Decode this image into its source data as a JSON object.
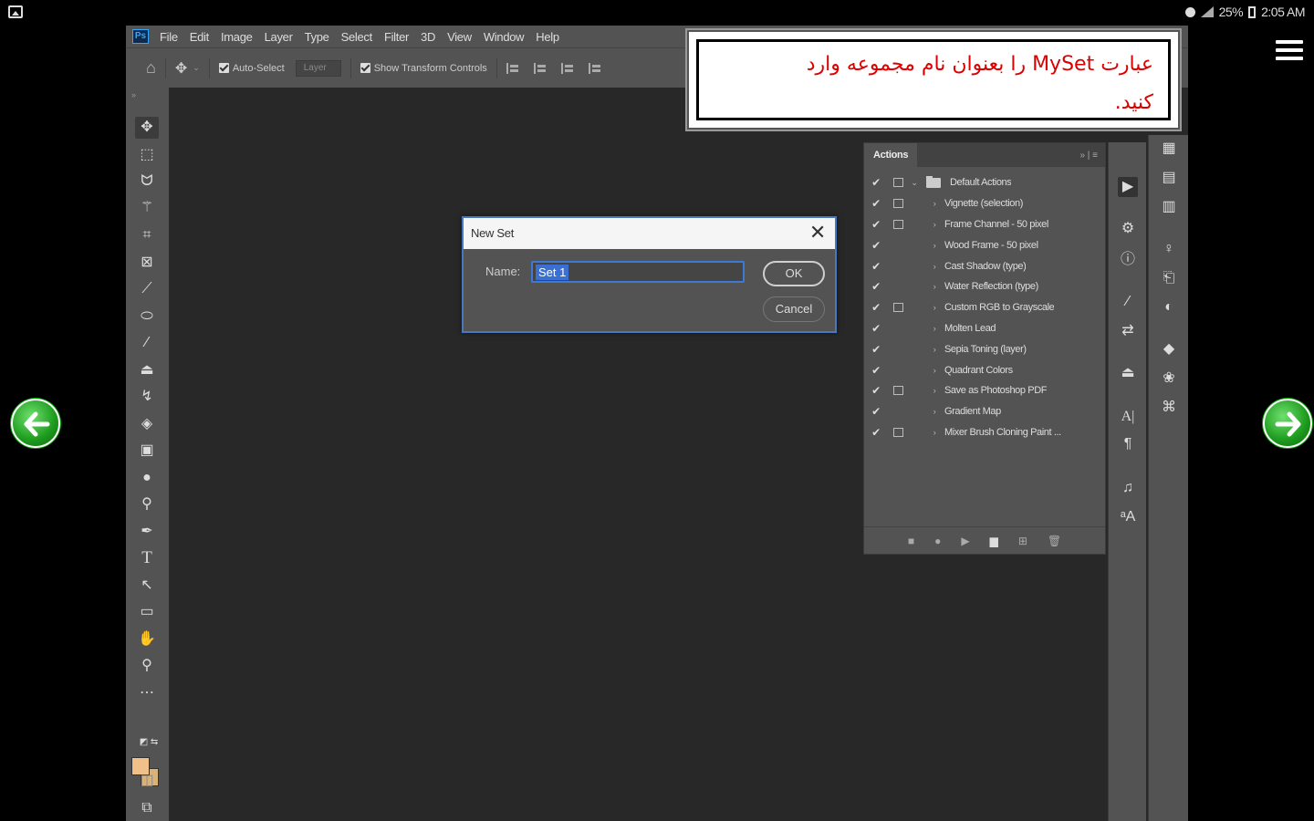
{
  "status_bar": {
    "battery": "25%",
    "time": "2:05 AM"
  },
  "photoshop": {
    "menu": [
      "File",
      "Edit",
      "Image",
      "Layer",
      "Type",
      "Select",
      "Filter",
      "3D",
      "View",
      "Window",
      "Help"
    ],
    "options_bar": {
      "auto_select": "Auto-Select",
      "layer_dropdown": "Layer",
      "show_transform": "Show Transform Controls"
    },
    "dialog": {
      "title": "New Set",
      "name_label": "Name:",
      "name_value": "Set 1",
      "ok_label": "OK",
      "cancel_label": "Cancel"
    },
    "actions_panel": {
      "tab": "Actions",
      "set_name": "Default Actions",
      "actions": [
        {
          "name": "Vignette (selection)",
          "dialog": true
        },
        {
          "name": "Frame Channel - 50 pixel",
          "dialog": true
        },
        {
          "name": "Wood Frame - 50 pixel",
          "dialog": false
        },
        {
          "name": "Cast Shadow (type)",
          "dialog": false
        },
        {
          "name": "Water Reflection (type)",
          "dialog": false
        },
        {
          "name": "Custom RGB to Grayscale",
          "dialog": true
        },
        {
          "name": "Molten Lead",
          "dialog": false
        },
        {
          "name": "Sepia Toning (layer)",
          "dialog": false
        },
        {
          "name": "Quadrant Colors",
          "dialog": false
        },
        {
          "name": "Save as Photoshop PDF",
          "dialog": true
        },
        {
          "name": "Gradient Map",
          "dialog": false
        },
        {
          "name": "Mixer Brush Cloning Paint ...",
          "dialog": true
        }
      ]
    }
  },
  "instruction": {
    "line1": "عبارت MySet را بعنوان نام مجموعه وارد",
    "line2": "کنید."
  },
  "colors": {
    "accent": "#3d7ad6",
    "instruction_text": "#dd0000",
    "nav_arrow": "#1c9a1c"
  }
}
